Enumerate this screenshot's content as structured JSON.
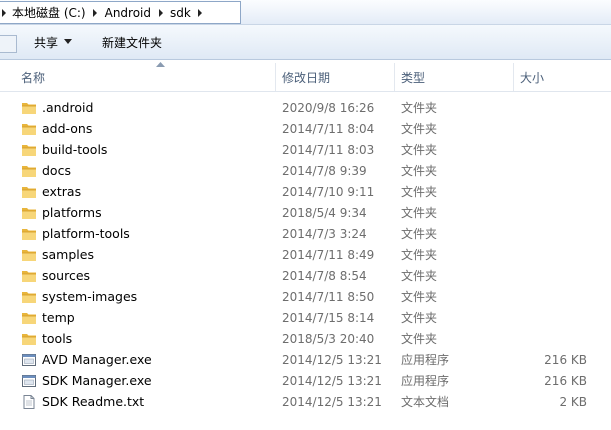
{
  "breadcrumb": {
    "items": [
      {
        "label": "本地磁盘 (C:)"
      },
      {
        "label": "Android"
      },
      {
        "label": "sdk"
      }
    ]
  },
  "toolbar": {
    "share_label": "共享",
    "new_folder_label": "新建文件夹"
  },
  "columns": {
    "name": "名称",
    "date": "修改日期",
    "type": "类型",
    "size": "大小"
  },
  "files": [
    {
      "name": ".android",
      "date": "2020/9/8 16:26",
      "type": "文件夹",
      "size": "",
      "icon": "folder-icon"
    },
    {
      "name": "add-ons",
      "date": "2014/7/11 8:04",
      "type": "文件夹",
      "size": "",
      "icon": "folder-icon"
    },
    {
      "name": "build-tools",
      "date": "2014/7/11 8:03",
      "type": "文件夹",
      "size": "",
      "icon": "folder-icon"
    },
    {
      "name": "docs",
      "date": "2014/7/8 9:39",
      "type": "文件夹",
      "size": "",
      "icon": "folder-icon"
    },
    {
      "name": "extras",
      "date": "2014/7/10 9:11",
      "type": "文件夹",
      "size": "",
      "icon": "folder-icon"
    },
    {
      "name": "platforms",
      "date": "2018/5/4 9:34",
      "type": "文件夹",
      "size": "",
      "icon": "folder-icon"
    },
    {
      "name": "platform-tools",
      "date": "2014/7/3 3:24",
      "type": "文件夹",
      "size": "",
      "icon": "folder-icon"
    },
    {
      "name": "samples",
      "date": "2014/7/11 8:49",
      "type": "文件夹",
      "size": "",
      "icon": "folder-icon"
    },
    {
      "name": "sources",
      "date": "2014/7/8 8:54",
      "type": "文件夹",
      "size": "",
      "icon": "folder-icon"
    },
    {
      "name": "system-images",
      "date": "2014/7/11 8:50",
      "type": "文件夹",
      "size": "",
      "icon": "folder-icon"
    },
    {
      "name": "temp",
      "date": "2014/7/15 8:14",
      "type": "文件夹",
      "size": "",
      "icon": "folder-icon"
    },
    {
      "name": "tools",
      "date": "2018/5/3 20:40",
      "type": "文件夹",
      "size": "",
      "icon": "folder-icon"
    },
    {
      "name": "AVD Manager.exe",
      "date": "2014/12/5 13:21",
      "type": "应用程序",
      "size": "216 KB",
      "icon": "application-icon"
    },
    {
      "name": "SDK Manager.exe",
      "date": "2014/12/5 13:21",
      "type": "应用程序",
      "size": "216 KB",
      "icon": "application-icon"
    },
    {
      "name": "SDK Readme.txt",
      "date": "2014/12/5 13:21",
      "type": "文本文档",
      "size": "2 KB",
      "icon": "text-document-icon"
    }
  ]
}
